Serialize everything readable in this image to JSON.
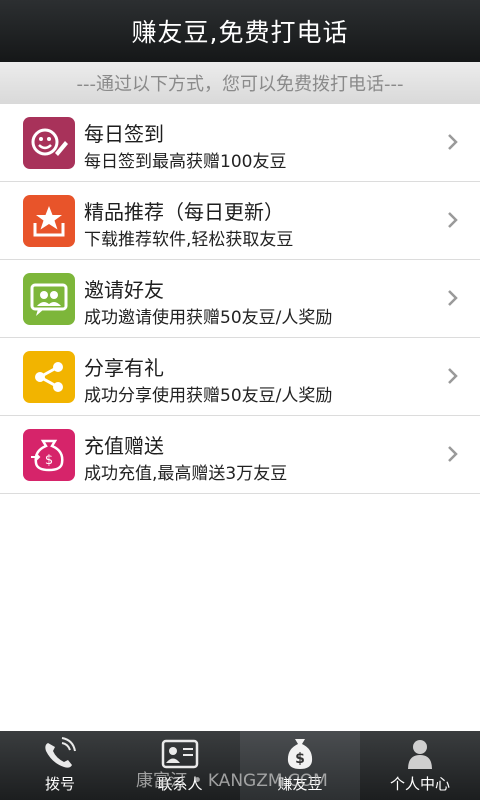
{
  "header": {
    "title": "赚友豆,免费打电话"
  },
  "subheader": {
    "text": "---通过以下方式，您可以免费拨打电话---"
  },
  "items": [
    {
      "title": "每日签到",
      "desc": "每日签到最高获赠100友豆",
      "icon": "sign-in-icon",
      "color": "#a8325a"
    },
    {
      "title": "精品推荐（每日更新）",
      "desc": "下载推荐软件,轻松获取友豆",
      "icon": "star-download-icon",
      "color": "#e8542a"
    },
    {
      "title": "邀请好友",
      "desc": "成功邀请使用获赠50友豆/人奖励",
      "icon": "invite-friends-icon",
      "color": "#7db63a"
    },
    {
      "title": "分享有礼",
      "desc": "成功分享使用获赠50友豆/人奖励",
      "icon": "share-icon",
      "color": "#f2b400"
    },
    {
      "title": "充值赠送",
      "desc": "成功充值,最高赠送3万友豆",
      "icon": "recharge-icon",
      "color": "#d6246a"
    }
  ],
  "tabs": [
    {
      "label": "拨号",
      "icon": "phone-icon"
    },
    {
      "label": "联系人",
      "icon": "contacts-icon"
    },
    {
      "label": "赚友豆",
      "icon": "money-bag-icon",
      "active": true
    },
    {
      "label": "个人中心",
      "icon": "person-icon"
    }
  ],
  "watermark": "康富汀 • KANGZM.COM"
}
